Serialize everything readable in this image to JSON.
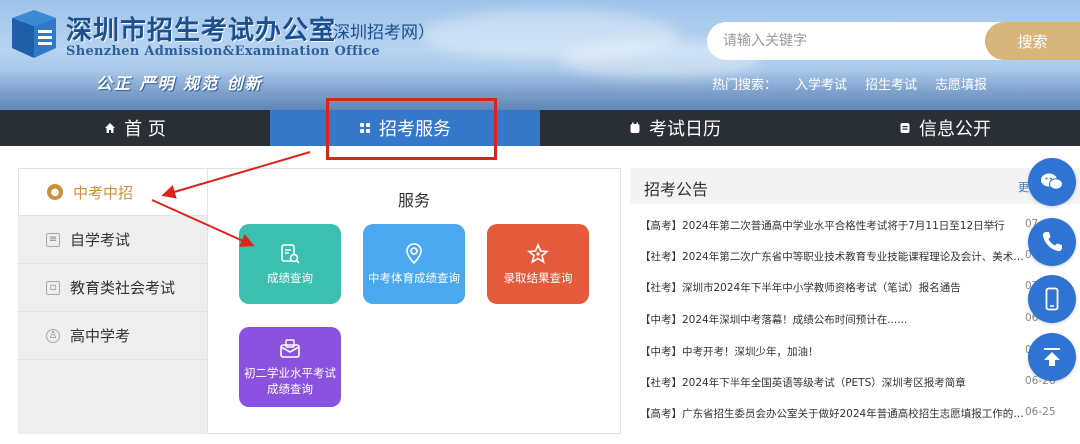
{
  "header": {
    "logo_cn": "深圳市招生考试办公室",
    "logo_sub": "（深圳招考网）",
    "logo_en": "Shenzhen Admission&Examination Office",
    "slogan": "公正 严明 规范 创新",
    "search_placeholder": "请输入关键字",
    "search_button": "搜索",
    "hot_label": "热门搜索：",
    "hot_links": [
      "入学考试",
      "招生考试",
      "志愿填报"
    ]
  },
  "nav": {
    "items": [
      {
        "label": "首 页",
        "icon": "home-icon"
      },
      {
        "label": "招考服务",
        "icon": "grid-icon"
      },
      {
        "label": "考试日历",
        "icon": "calendar-icon"
      },
      {
        "label": "信息公开",
        "icon": "info-icon"
      }
    ],
    "active_index": 1
  },
  "sidebar": {
    "items": [
      {
        "label": "中考中招",
        "icon": "badge-icon"
      },
      {
        "label": "自学考试",
        "icon": "book-icon"
      },
      {
        "label": "教育类社会考试",
        "icon": "book-icon"
      },
      {
        "label": "高中学考",
        "icon": "person-icon"
      }
    ],
    "active_index": 0
  },
  "services": {
    "title": "服务",
    "tiles": [
      {
        "label": "成绩查询",
        "color": "#3bbfae",
        "icon": "document-search-icon"
      },
      {
        "label": "中考体育成绩查询",
        "color": "#4aa8ee",
        "icon": "location-search-icon"
      },
      {
        "label": "录取结果查询",
        "color": "#e65a3c",
        "icon": "star-icon"
      },
      {
        "label": "初二学业水平考试成绩查询",
        "label_line1": "初二学业水平考试",
        "label_line2": "成绩查询",
        "color": "#8a52df",
        "icon": "envelope-icon"
      }
    ]
  },
  "notices": {
    "title": "招考公告",
    "more": "更",
    "items": [
      {
        "text": "【高考】2024年第二次普通高中学业水平合格性考试将于7月11日至12日举行",
        "date": "07"
      },
      {
        "text": "【社考】2024年第二次广东省中等职业技术教育专业技能课程理论及会计、美术基...",
        "date": "07"
      },
      {
        "text": "【社考】深圳市2024年下半年中小学教师资格考试（笔试）报名通告",
        "date": "07"
      },
      {
        "text": "【中考】2024年深圳中考落幕！成绩公布时间预计在......",
        "date": "06-"
      },
      {
        "text": "【中考】中考开考！深圳少年，加油！",
        "date": "06"
      },
      {
        "text": "【社考】2024年下半年全国英语等级考试（PETS）深圳考区报考简章",
        "date": "06-26"
      },
      {
        "text": "【高考】广东省招生委员会办公室关于做好2024年普通高校招生志愿填报工作的通...",
        "date": "06-25"
      }
    ]
  },
  "floating": [
    "wechat-icon",
    "phone-icon",
    "mobile-icon",
    "back-to-top-icon"
  ],
  "colors": {
    "nav_bg": "#2a2e35",
    "nav_active": "#3578c9",
    "accent_gold": "#c8923a",
    "highlight_red": "#e0221b"
  }
}
